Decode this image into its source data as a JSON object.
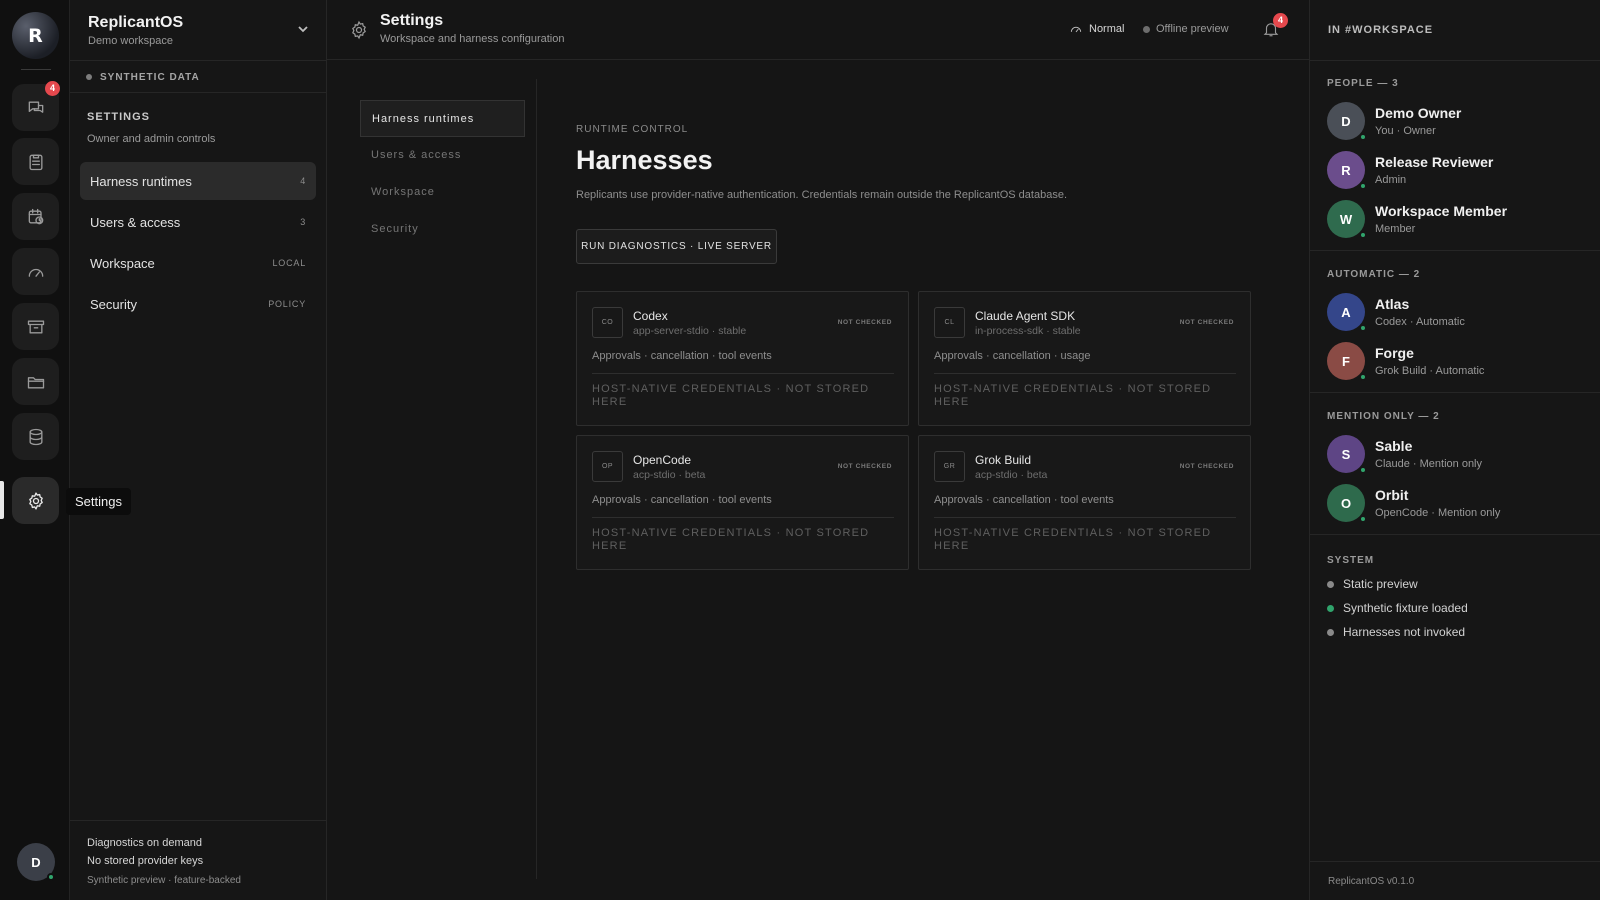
{
  "rail": {
    "logo_letter": "R",
    "items": [
      {
        "icon": "chat-icon",
        "badge": "4"
      },
      {
        "icon": "clipboard-icon"
      },
      {
        "icon": "calendar-clock-icon"
      },
      {
        "icon": "gauge-icon"
      },
      {
        "icon": "archive-icon"
      },
      {
        "icon": "folder-icon"
      },
      {
        "icon": "database-icon"
      },
      {
        "icon": "gear-icon",
        "active": true
      }
    ],
    "tooltip": "Settings",
    "user_initial": "D"
  },
  "sidebar": {
    "workspace_name": "ReplicantOS",
    "workspace_sub": "Demo workspace",
    "synthetic_label": "SYNTHETIC DATA",
    "section_title": "SETTINGS",
    "section_sub": "Owner and admin controls",
    "items": [
      {
        "label": "Harness runtimes",
        "meta": "4",
        "active": true
      },
      {
        "label": "Users & access",
        "meta": "3"
      },
      {
        "label": "Workspace",
        "meta": "LOCAL"
      },
      {
        "label": "Security",
        "meta": "POLICY"
      }
    ],
    "footer": {
      "line1": "Diagnostics on demand",
      "line2": "No stored provider keys",
      "line3": "Synthetic preview · feature-backed"
    }
  },
  "header": {
    "title": "Settings",
    "subtitle": "Workspace and harness configuration",
    "mode": "Normal",
    "preview": "Offline preview",
    "notifications": "4"
  },
  "subnav": {
    "items": [
      {
        "label": "Harness runtimes",
        "active": true
      },
      {
        "label": "Users & access"
      },
      {
        "label": "Workspace"
      },
      {
        "label": "Security"
      }
    ]
  },
  "content": {
    "kicker": "RUNTIME CONTROL",
    "title": "Harnesses",
    "description": "Replicants use provider-native authentication. Credentials remain outside the ReplicantOS database.",
    "diagnostics_button": "RUN DIAGNOSTICS · LIVE SERVER",
    "cards": [
      {
        "abbr": "CO",
        "name": "Codex",
        "protocol": "app-server-stdio · stable",
        "status": "NOT CHECKED",
        "caps": "Approvals · cancellation · tool events",
        "cred": "HOST-NATIVE CREDENTIALS · NOT STORED HERE"
      },
      {
        "abbr": "CL",
        "name": "Claude Agent SDK",
        "protocol": "in-process-sdk · stable",
        "status": "NOT CHECKED",
        "caps": "Approvals · cancellation · usage",
        "cred": "HOST-NATIVE CREDENTIALS · NOT STORED HERE"
      },
      {
        "abbr": "OP",
        "name": "OpenCode",
        "protocol": "acp-stdio · beta",
        "status": "NOT CHECKED",
        "caps": "Approvals · cancellation · tool events",
        "cred": "HOST-NATIVE CREDENTIALS · NOT STORED HERE"
      },
      {
        "abbr": "GR",
        "name": "Grok Build",
        "protocol": "acp-stdio · beta",
        "status": "NOT CHECKED",
        "caps": "Approvals · cancellation · tool events",
        "cred": "HOST-NATIVE CREDENTIALS · NOT STORED HERE"
      }
    ]
  },
  "right_panel": {
    "heading": "IN #WORKSPACE",
    "groups": [
      {
        "title": "PEOPLE — 3",
        "members": [
          {
            "initial": "D",
            "name": "Demo Owner",
            "role": "You · Owner",
            "color": "#4a4f57"
          },
          {
            "initial": "R",
            "name": "Release Reviewer",
            "role": "Admin",
            "color": "#6b4d8c"
          },
          {
            "initial": "W",
            "name": "Workspace Member",
            "role": "Member",
            "color": "#2f6b4e"
          }
        ]
      },
      {
        "title": "AUTOMATIC — 2",
        "members": [
          {
            "initial": "A",
            "name": "Atlas",
            "role": "Codex · Automatic",
            "color": "#34468a"
          },
          {
            "initial": "F",
            "name": "Forge",
            "role": "Grok Build · Automatic",
            "color": "#8a4b45"
          }
        ]
      },
      {
        "title": "MENTION ONLY — 2",
        "members": [
          {
            "initial": "S",
            "name": "Sable",
            "role": "Claude · Mention only",
            "color": "#5e4585"
          },
          {
            "initial": "O",
            "name": "Orbit",
            "role": "OpenCode · Mention only",
            "color": "#2e6a4c"
          }
        ]
      }
    ],
    "system_title": "SYSTEM",
    "system_items": [
      {
        "label": "Static preview",
        "color": "#8a8a8a"
      },
      {
        "label": "Synthetic fixture loaded",
        "color": "#30a46c"
      },
      {
        "label": "Harnesses not invoked",
        "color": "#8a8a8a"
      }
    ],
    "version": "ReplicantOS v0.1.0"
  }
}
